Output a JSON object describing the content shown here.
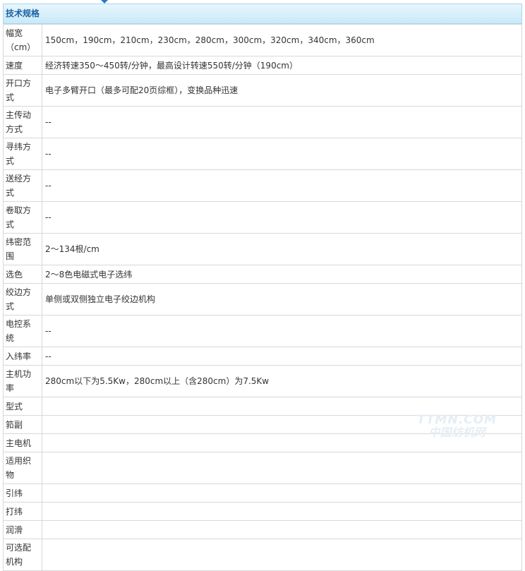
{
  "header": {
    "title": "技术规格"
  },
  "rows": [
    {
      "label": "幅宽（cm）",
      "value": "150cm，190cm，210cm，230cm，280cm，300cm，320cm，340cm，360cm"
    },
    {
      "label": "速度",
      "value": "经济转速350～450转/分钟，最高设计转速550转/分钟（190cm）"
    },
    {
      "label": "开口方式",
      "value": "电子多臂开口（最多可配20页综框），变换品种迅速"
    },
    {
      "label": "主传动方式",
      "value": "--"
    },
    {
      "label": "寻纬方式",
      "value": "--"
    },
    {
      "label": "送经方式",
      "value": "--"
    },
    {
      "label": "卷取方式",
      "value": "--"
    },
    {
      "label": "纬密范围",
      "value": "2～134根/cm"
    },
    {
      "label": "选色",
      "value": "2～8色电磁式电子选纬"
    },
    {
      "label": "绞边方式",
      "value": "单侧或双侧独立电子绞边机构"
    },
    {
      "label": "电控系统",
      "value": "--"
    },
    {
      "label": "入纬率",
      "value": "--"
    },
    {
      "label": "主机功率",
      "value": "280cm以下为5.5Kw，280cm以上（含280cm）为7.5Kw"
    },
    {
      "label": "型式",
      "value": ""
    },
    {
      "label": "筘副",
      "value": ""
    },
    {
      "label": "主电机",
      "value": ""
    },
    {
      "label": "适用织物",
      "value": ""
    },
    {
      "label": "引纬",
      "value": ""
    },
    {
      "label": "打纬",
      "value": ""
    },
    {
      "label": "润滑",
      "value": ""
    },
    {
      "label": "可选配机构",
      "value": ""
    }
  ],
  "watermark": {
    "line1": "TTMN.COM",
    "line2": "中国纺机网"
  }
}
